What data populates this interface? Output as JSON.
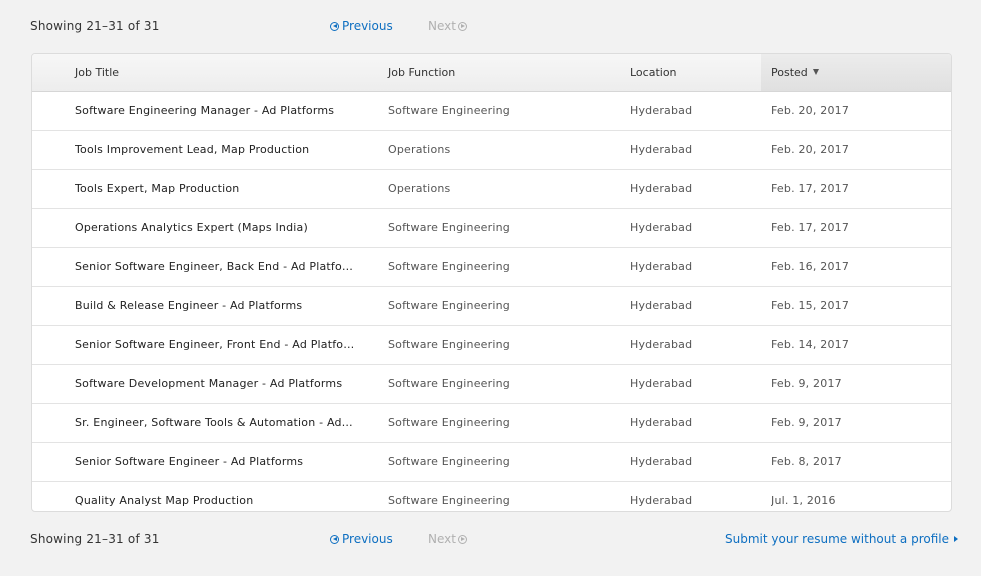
{
  "pager": {
    "showing": "Showing 21–31 of 31",
    "previous": "Previous",
    "next": "Next",
    "submit_resume": "Submit your resume without a profile"
  },
  "table": {
    "headers": {
      "title": "Job Title",
      "function": "Job Function",
      "location": "Location",
      "posted": "Posted"
    },
    "sort": {
      "column": "posted",
      "direction": "descending"
    },
    "rows": [
      {
        "title": "Software Engineering Manager - Ad Platforms",
        "function": "Software Engineering",
        "location": "Hyderabad",
        "posted": "Feb. 20, 2017"
      },
      {
        "title": "Tools Improvement Lead, Map Production",
        "function": "Operations",
        "location": "Hyderabad",
        "posted": "Feb. 20, 2017"
      },
      {
        "title": "Tools Expert, Map Production",
        "function": "Operations",
        "location": "Hyderabad",
        "posted": "Feb. 17, 2017"
      },
      {
        "title": "Operations Analytics Expert (Maps India)",
        "function": "Software Engineering",
        "location": "Hyderabad",
        "posted": "Feb. 17, 2017"
      },
      {
        "title": "Senior Software Engineer, Back End - Ad Platforms",
        "function": "Software Engineering",
        "location": "Hyderabad",
        "posted": "Feb. 16, 2017"
      },
      {
        "title": "Build & Release Engineer - Ad Platforms",
        "function": "Software Engineering",
        "location": "Hyderabad",
        "posted": "Feb. 15, 2017"
      },
      {
        "title": "Senior Software Engineer, Front End - Ad Platforms",
        "function": "Software Engineering",
        "location": "Hyderabad",
        "posted": "Feb. 14, 2017"
      },
      {
        "title": "Software Development Manager - Ad Platforms",
        "function": "Software Engineering",
        "location": "Hyderabad",
        "posted": "Feb. 9, 2017"
      },
      {
        "title": "Sr. Engineer, Software Tools & Automation - Ad P...",
        "function": "Software Engineering",
        "location": "Hyderabad",
        "posted": "Feb. 9, 2017"
      },
      {
        "title": "Senior Software Engineer - Ad Platforms",
        "function": "Software Engineering",
        "location": "Hyderabad",
        "posted": "Feb. 8, 2017"
      },
      {
        "title": "Quality Analyst Map Production",
        "function": "Software Engineering",
        "location": "Hyderabad",
        "posted": "Jul. 1, 2016"
      }
    ]
  },
  "colors": {
    "link": "#0e6fc1",
    "disabled": "#b0b0b0",
    "background": "#f2f2f2"
  },
  "icons": {
    "previous": "circle-chevron-left-icon",
    "next": "circle-chevron-right-icon",
    "sort": "caret-down-icon",
    "submit": "triangle-right-icon"
  }
}
